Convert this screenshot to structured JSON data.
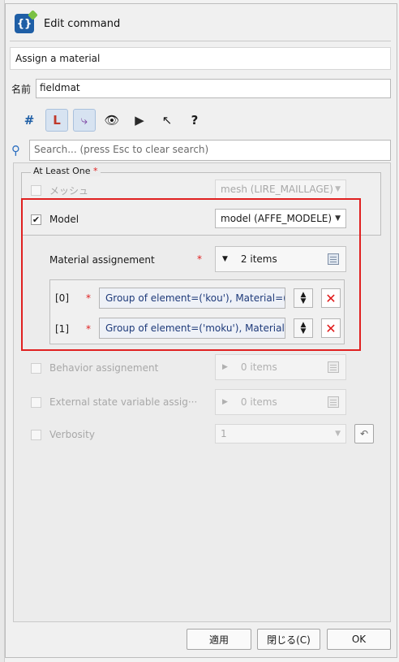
{
  "window": {
    "title": "Edit command"
  },
  "command": {
    "description": "Assign a material",
    "name_label": "名前",
    "name_value": "fieldmat"
  },
  "search": {
    "placeholder": "Search... (press Esc to clear search)"
  },
  "group": {
    "title": "At Least One",
    "required_mark": "*"
  },
  "fields": {
    "mesh": {
      "label": "メッシュ",
      "value": "mesh (LIRE_MAILLAGE)",
      "checked": false,
      "enabled": false
    },
    "model": {
      "label": "Model",
      "value": "model (AFFE_MODELE)",
      "checked": true,
      "enabled": true
    },
    "material_assignment": {
      "label": "Material assignement",
      "required_mark": "*",
      "count_label": "2 items",
      "items": [
        {
          "index": "[0]",
          "required_mark": "*",
          "value": "Group of element=('kou'), Material=(···"
        },
        {
          "index": "[1]",
          "required_mark": "*",
          "value": "Group of element=('moku'), Material···"
        }
      ]
    },
    "behavior_assignment": {
      "label": "Behavior assignement",
      "count_label": "0 items"
    },
    "external_state": {
      "label": "External state variable assig···",
      "count_label": "0 items"
    },
    "verbosity": {
      "label": "Verbosity",
      "value": "1"
    }
  },
  "buttons": {
    "apply": "適用",
    "close": "閉じる(C)",
    "ok": "OK"
  },
  "colors": {
    "accent": "#1f5fa6",
    "required": "#e02020",
    "highlight_border": "#e02020"
  }
}
